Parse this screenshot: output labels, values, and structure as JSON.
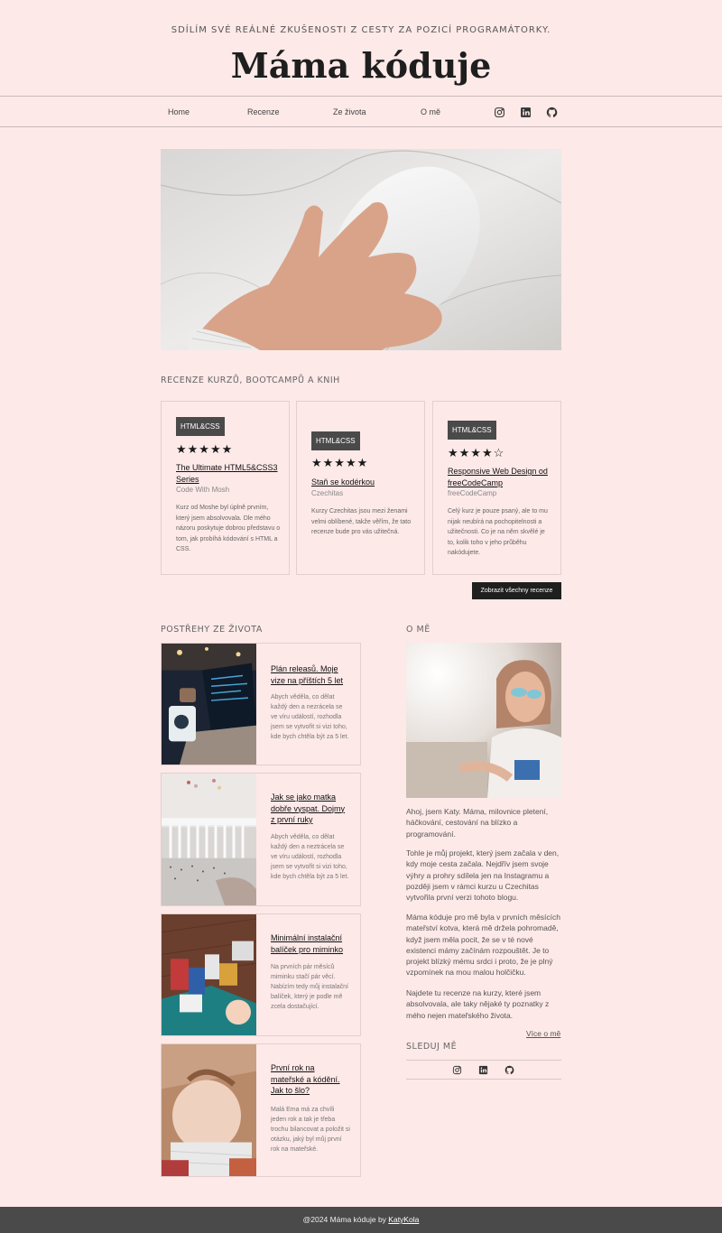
{
  "header": {
    "tagline": "SDÍLÍM SVÉ REÁLNÉ ZKUŠENOSTI Z CESTY ZA POZICÍ PROGRAMÁTORKY.",
    "title": "Máma kóduje"
  },
  "nav": {
    "items": [
      {
        "label": "Home"
      },
      {
        "label": "Recenze"
      },
      {
        "label": "Ze života"
      },
      {
        "label": "O mě"
      }
    ],
    "social": [
      "instagram-icon",
      "linkedin-icon",
      "github-icon"
    ]
  },
  "reviews": {
    "heading": "RECENZE KURZŮ, BOOTCAMPŮ A KNIH",
    "cards": [
      {
        "badge": "HTML&CSS",
        "stars": "★★★★★",
        "rating": 5,
        "title": "The Ultimate HTML5&CSS3 Series",
        "author": "Code With Mosh",
        "text": "Kurz od Moshe byl úplně prvním, který jsem absolvovala. Dle mého názoru poskytuje dobrou představu o tom, jak probíhá kódování s HTML a CSS."
      },
      {
        "badge": "HTML&CSS",
        "stars": "★★★★★",
        "rating": 5,
        "title": "Staň se kodérkou",
        "author": "Czechitas",
        "text": "Kurzy Czechitas jsou mezi ženami velmi oblíbené, takže věřím, že tato recenze bude pro vás užitečná."
      },
      {
        "badge": "HTML&CSS",
        "stars": "★★★★☆",
        "rating": 4,
        "title": "Responsive Web Design od freeCodeCamp",
        "author": "freeCodeCamp",
        "text": "Celý kurz je pouze psaný, ale to mu nijak neubírá na pochopitelnosti a užitečnosti. Co je na něm skvělé je to, kolik toho v jeho průběhu nakódujete."
      }
    ],
    "button": "Zobrazit všechny recenze"
  },
  "life": {
    "heading": "POSTŘEHY ZE ŽIVOTA",
    "posts": [
      {
        "title": "Plán releasů. Moje vize na příštích 5 let",
        "text": "Abych věděla, co dělat každý den a nezrácela se ve víru událostí, rozhodla jsem se vytvořit si vizi toho, kde bych chtěla být za 5 let."
      },
      {
        "title": "Jak se jako matka dobře vyspat. Dojmy z první ruky",
        "text": "Abych věděla, co dělat každý den a neztrácela se ve víru událostí, rozhodla jsem se vytvořit si vizi toho, kde bych chtěla být za 5 let."
      },
      {
        "title": "Minimální instalační balíček pro miminko",
        "text": "Na prvních pár měsíců miminku stačí pár věcí. Nabízím tedy můj instalační balíček, který je podle mě zcela dostačující."
      },
      {
        "title": "První rok na mateřské a kódění. Jak to šlo?",
        "text": "Malá Ema má za chvíli jeden rok a tak je třeba trochu bilancovat a položit si otázku, jaký byl můj první rok na mateřské."
      }
    ]
  },
  "about": {
    "heading": "O MĚ",
    "paragraphs": [
      "Ahoj, jsem Katy. Máma, milovnice pletení, háčkování, cestování na blízko a programování.",
      "Tohle je můj projekt, který jsem začala v den, kdy moje cesta začala. Nejdřív jsem svoje výhry a prohry sdílela jen na Instagramu a později jsem v rámci kurzu u Czechitas vytvořila první verzi tohoto blogu.",
      "Máma kóduje pro mě byla v prvních měsících mateřství kotva, která mě držela pohromadě, když jsem měla pocit, že se v té nové existenci mámy začínám rozpouštět. Je to projekt blízký mému srdci i proto, že je plný vzpomínek na mou malou holčičku.",
      "Najdete tu recenze na kurzy, které jsem absolvovala, ale taky nějaké ty poznatky z mého nejen mateřského života."
    ],
    "more": "Více o mě",
    "follow_heading": "SLEDUJ MĚ"
  },
  "footer": {
    "text": "@2024 Máma kóduje by ",
    "link": "KatyKola"
  }
}
